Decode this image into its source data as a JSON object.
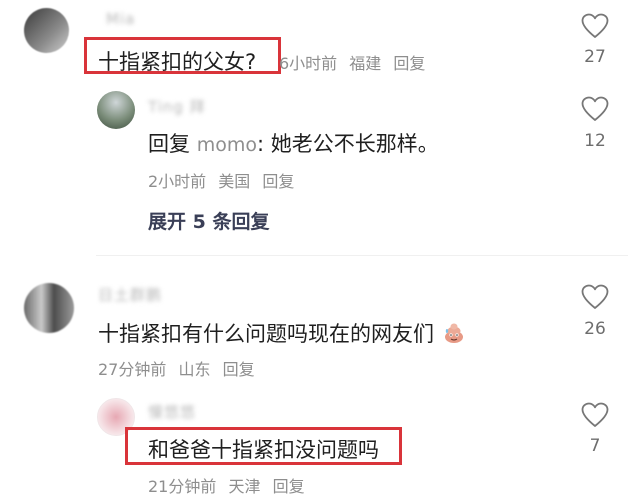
{
  "comments": [
    {
      "username": "Mia",
      "text": "十指紧扣的父女?",
      "meta": {
        "time": "6小时前",
        "location": "福建",
        "reply": "回复"
      },
      "likes": "27",
      "replies": [
        {
          "username": "Ting 拜",
          "reply_prefix": "回复",
          "mention": "momo",
          "text": ": 她老公不长那样。",
          "meta": {
            "time": "2小时前",
            "location": "美国",
            "reply": "回复"
          },
          "likes": "12"
        }
      ],
      "expand_label": "展开 5 条回复"
    },
    {
      "username": "日土群鹏",
      "text": "十指紧扣有什么问题吗现在的网友们",
      "emoji": "poop-face-emoji",
      "meta": {
        "time": "27分钟前",
        "location": "山东",
        "reply": "回复"
      },
      "likes": "26",
      "replies": [
        {
          "username": "慢悠悠",
          "text": "和爸爸十指紧扣没问题吗",
          "meta": {
            "time": "21分钟前",
            "location": "天津",
            "reply": "回复"
          },
          "likes": "7"
        }
      ]
    }
  ],
  "colors": {
    "highlight": "#d9343a",
    "meta": "#8e8e8e",
    "expand": "#3a3f57"
  }
}
